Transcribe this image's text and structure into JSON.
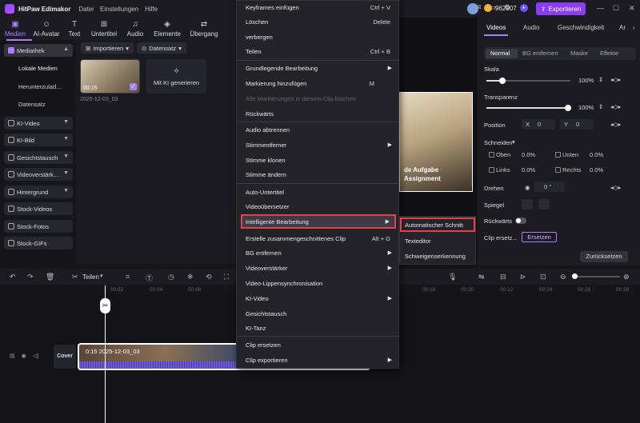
{
  "app": {
    "title": "HitPaw Edimakor",
    "menus": [
      "Datei",
      "Einstellungen",
      "Hilfe"
    ],
    "credits": "962907",
    "export_label": "Exportieren"
  },
  "toolbar": {
    "items": [
      "Medien",
      "AI-Avatar",
      "Text",
      "Untertitel",
      "Audio",
      "Elemente",
      "Übergang"
    ],
    "active": "Medien"
  },
  "sidebar": {
    "mediathek": "Mediathek",
    "subitems": [
      "Lokale Medien",
      "Herunterzulad...",
      "Datensatz"
    ],
    "items": [
      "KI-Video",
      "KI-Bild",
      "Gesichtstausch",
      "Videoverstärk...",
      "Hintergrund",
      "Stock-Videos",
      "Stock-Fotos",
      "Stock-GIFs"
    ]
  },
  "media": {
    "import_label": "Importieren",
    "dataset_label": "Datensatz",
    "thumb_duration": "00:15",
    "thumb_date": "2025-12-03_03",
    "ai_generate": "Mit KI generieren"
  },
  "preview": {
    "overlay_line1": "de Aufgabe",
    "overlay_line2": "Assignment"
  },
  "context_menu": {
    "items": [
      {
        "label": "Keyframes einfügen",
        "shortcut": "Ctrl + V"
      },
      {
        "label": "Löschen",
        "shortcut": "Delete"
      },
      {
        "label": "verbergen",
        "shortcut": ""
      },
      {
        "label": "Teilen",
        "shortcut": "Ctrl + B"
      },
      {
        "label": "Grundlegende Bearbeitung",
        "shortcut": "▶"
      },
      {
        "label": "Markierung hinzufügen",
        "shortcut": "M"
      },
      {
        "label": "Alle Markierungen in diesem Clip löschen",
        "shortcut": ""
      },
      {
        "label": "Rückwärts",
        "shortcut": ""
      },
      {
        "label": "Audio abtrennen",
        "shortcut": ""
      },
      {
        "label": "Stimmentferner",
        "shortcut": "▶"
      },
      {
        "label": "Stimme klonen",
        "shortcut": ""
      },
      {
        "label": "Stimme ändern",
        "shortcut": ""
      },
      {
        "label": "Auto-Untertitel",
        "shortcut": ""
      },
      {
        "label": "Videoübersetzer",
        "shortcut": ""
      },
      {
        "label": "Intelligente Bearbeitung",
        "shortcut": "▶"
      },
      {
        "label": "Erstelle zusammengeschnittenes Clip",
        "shortcut": "Alt + G"
      },
      {
        "label": "BG entfernen",
        "shortcut": "▶"
      },
      {
        "label": "Videoverstärker",
        "shortcut": "▶"
      },
      {
        "label": "Video-Lippensynchronisation",
        "shortcut": ""
      },
      {
        "label": "KI-Video",
        "shortcut": "▶"
      },
      {
        "label": "Gesichtstausch",
        "shortcut": ""
      },
      {
        "label": "KI-Tanz",
        "shortcut": ""
      },
      {
        "label": "Clip ersetzen",
        "shortcut": ""
      },
      {
        "label": "Clip exportieren",
        "shortcut": "▶"
      }
    ],
    "submenu": [
      "Automatischer Schnitt",
      "Texteditor",
      "Schweigenserkennung"
    ]
  },
  "right_panel": {
    "tabs": [
      "Videos",
      "Audio",
      "Geschwindigkeit",
      "Ar"
    ],
    "subtabs": [
      "Normal",
      "BG entfernen",
      "Maske",
      "Effekte"
    ],
    "scale_label": "Skala",
    "scale_value": "100%",
    "transparency_label": "Transparenz",
    "transparency_value": "100%",
    "position_label": "Position",
    "pos_x_label": "X",
    "pos_x": "0",
    "pos_y_label": "Y",
    "pos_y": "0",
    "crop_label": "Schneiden",
    "crop": {
      "oben": "Oben",
      "oben_v": "0.0%",
      "unten": "Unten",
      "unten_v": "0.0%",
      "links": "Links",
      "links_v": "0.0%",
      "rechts": "Rechts",
      "rechts_v": "0.0%"
    },
    "rotate_label": "Drehen",
    "rotate_value": "0 °",
    "mirror_label": "Spiegel",
    "reverse_label": "Rückwärts",
    "replace_label": "Clip ersetz...",
    "replace_btn": "Ersetzen",
    "reset_btn": "Zurücksetzen"
  },
  "timeline": {
    "split_label": "Teilen",
    "ruler": [
      "00:02",
      "00:04",
      "00:06",
      "00:18",
      "00:20",
      "00:22",
      "00:24",
      "00:26",
      "00:28"
    ],
    "cover_label": "Cover",
    "clip_label": "0:15  2025-12-03_03"
  }
}
